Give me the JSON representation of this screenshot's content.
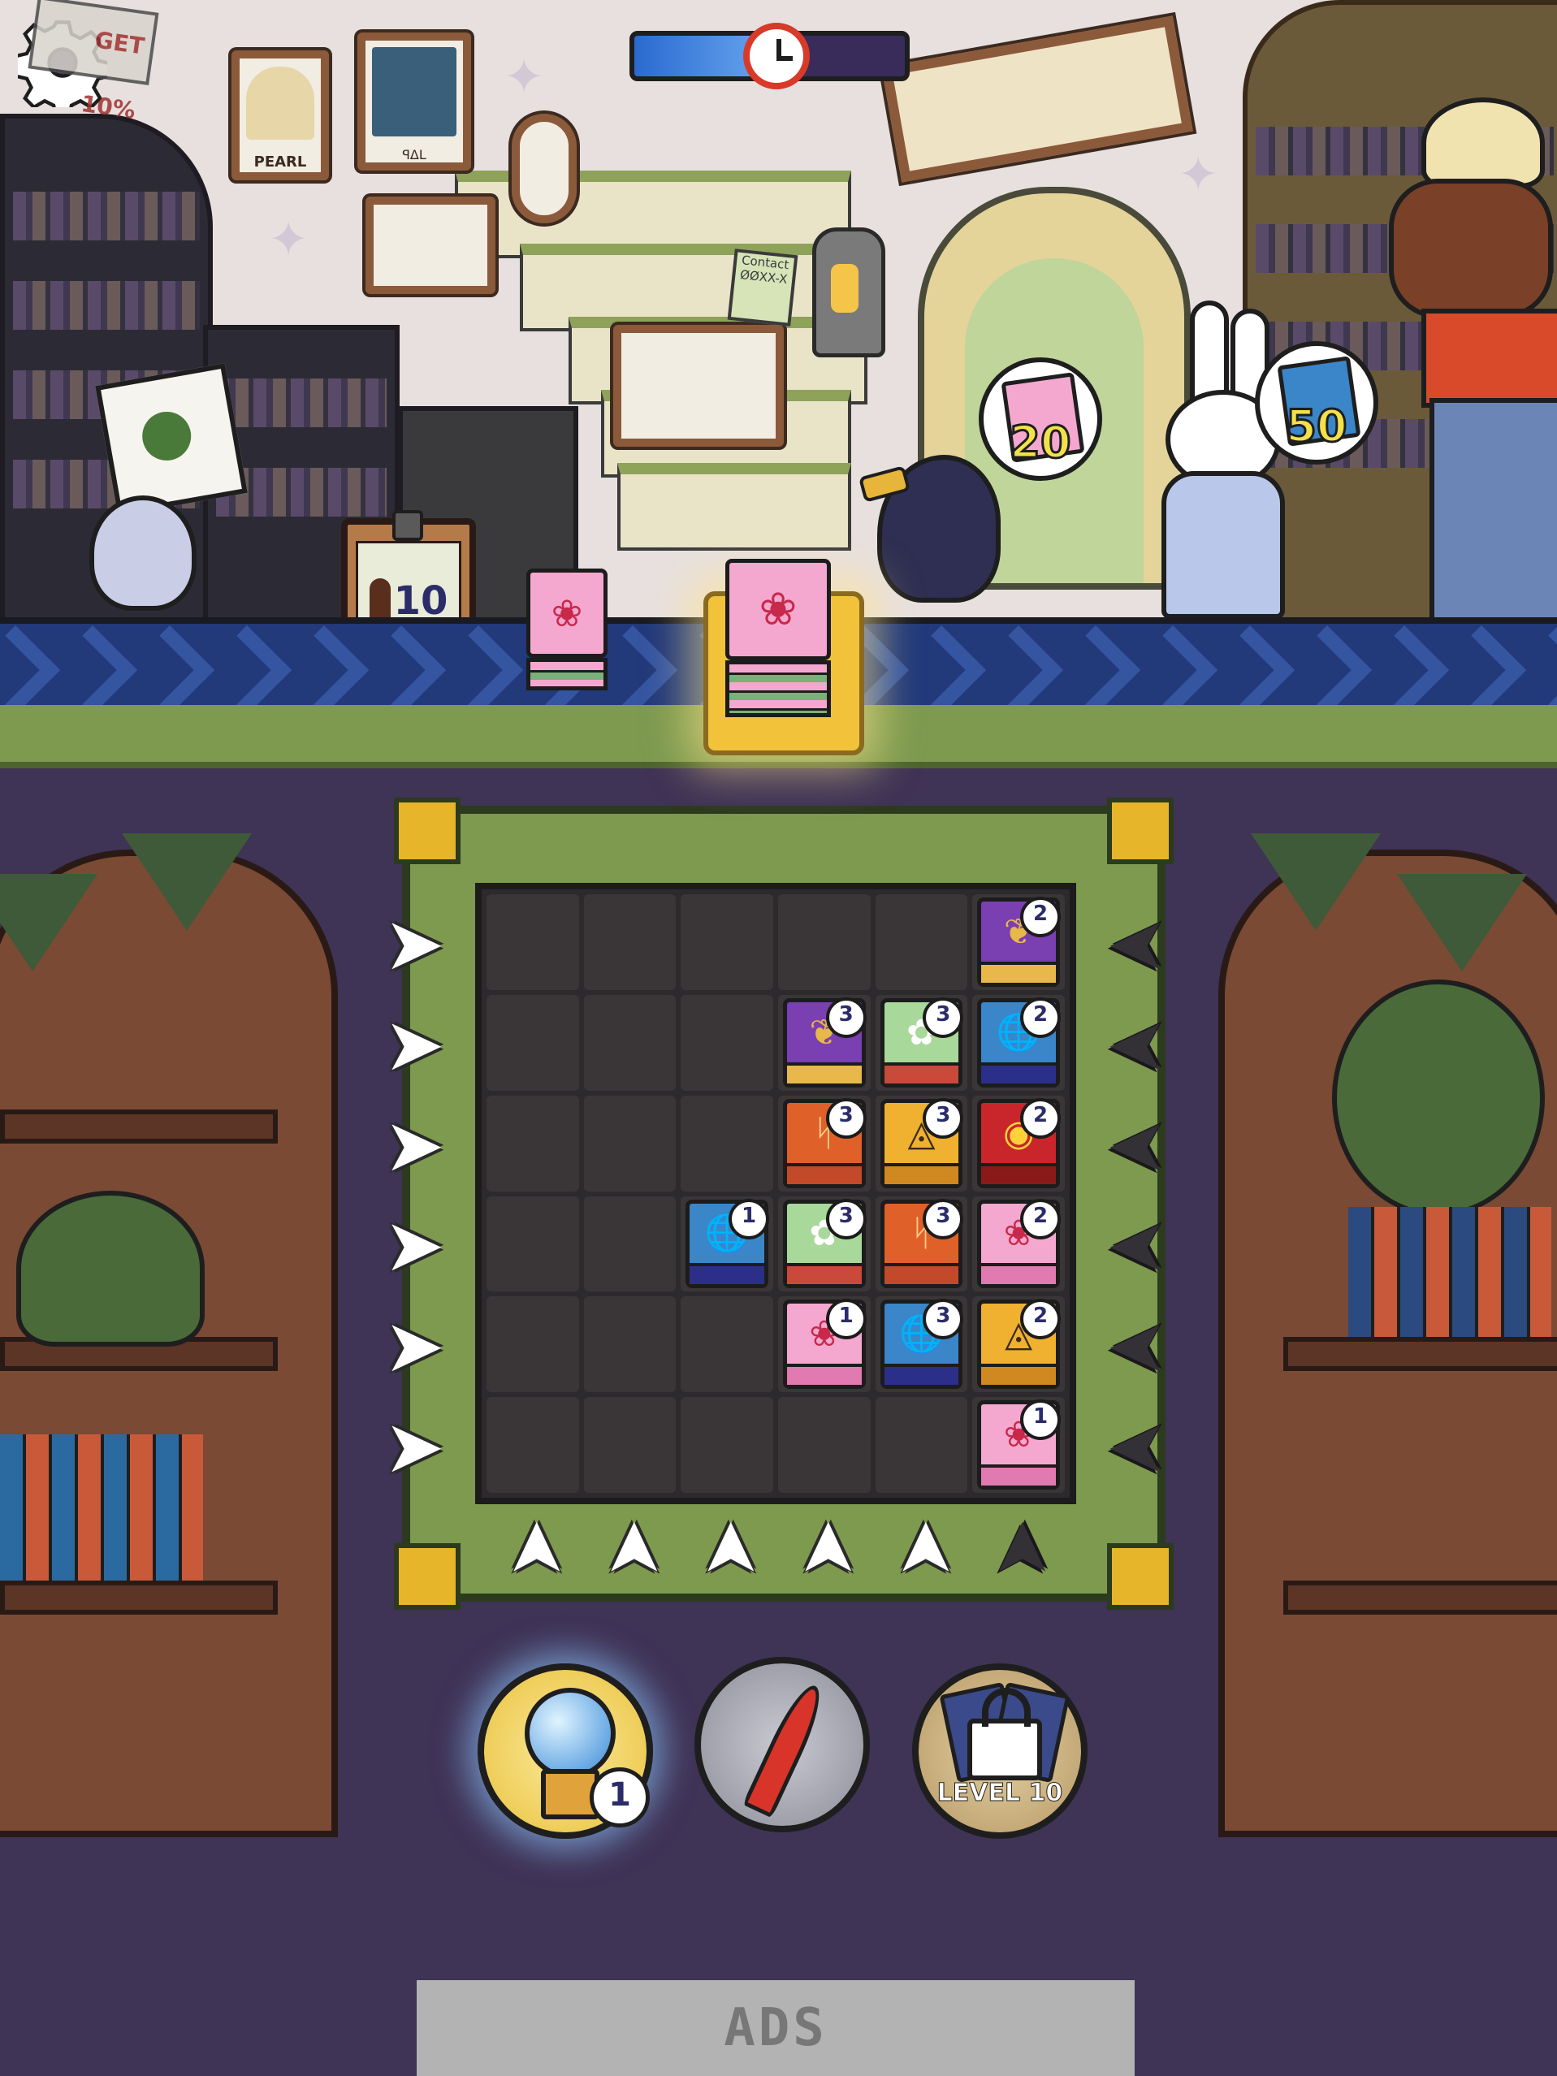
{
  "hud": {
    "settings_icon": "gear-icon",
    "timer_icon": "alarm-clock-icon",
    "timer_progress": 0.52,
    "sign_text": "GET 10%"
  },
  "scene": {
    "frames": [
      "PEARL",
      "ꟼΔL"
    ],
    "notice": "Contact",
    "notice_number": "ØØXX-X"
  },
  "order_clipboard": {
    "icon": "person-icon",
    "value": "10"
  },
  "customers": [
    {
      "name": "crow",
      "request_book": "rose",
      "request_count": "20"
    },
    {
      "name": "rabbit",
      "request_book": "globe",
      "request_count": "50"
    },
    {
      "name": "moose"
    }
  ],
  "conveyor": {
    "books": [
      "rose",
      "rose"
    ]
  },
  "grid": {
    "rows": [
      [
        null,
        null,
        null,
        null,
        null,
        {
          "type": "vine",
          "count": "2"
        }
      ],
      [
        null,
        null,
        null,
        {
          "type": "vine",
          "count": "3"
        },
        {
          "type": "flower",
          "count": "3"
        },
        {
          "type": "globe",
          "count": "2"
        }
      ],
      [
        null,
        null,
        null,
        {
          "type": "rune",
          "count": "3"
        },
        {
          "type": "triangle",
          "count": "3"
        },
        {
          "type": "eye",
          "count": "2"
        }
      ],
      [
        null,
        null,
        {
          "type": "globe",
          "count": "1"
        },
        {
          "type": "flower",
          "count": "3"
        },
        {
          "type": "rune",
          "count": "3"
        },
        {
          "type": "rose",
          "count": "2"
        }
      ],
      [
        null,
        null,
        null,
        {
          "type": "rose",
          "count": "1"
        },
        {
          "type": "globe",
          "count": "3"
        },
        {
          "type": "triangle",
          "count": "2"
        }
      ],
      [
        null,
        null,
        null,
        null,
        null,
        {
          "type": "rose",
          "count": "1"
        }
      ]
    ],
    "left_arrows": [
      "light",
      "light",
      "light",
      "light",
      "light",
      "light"
    ],
    "right_arrows": [
      "dark",
      "dark",
      "dark",
      "dark",
      "dark",
      "dark"
    ],
    "bottom_arrows": [
      "light",
      "light",
      "light",
      "light",
      "light",
      "dark"
    ]
  },
  "book_styles": {
    "vine": {
      "bg": "#7a3fb0",
      "emb": "❦",
      "emb_color": "#e8b84a",
      "spine": "#e8b84a"
    },
    "flower": {
      "bg": "#a8d89a",
      "emb": "✿",
      "emb_color": "#ffffff",
      "spine": "#c94a3a"
    },
    "globe": {
      "bg": "#3a86c8",
      "emb": "🌐",
      "emb_color": "#ffffff",
      "spine": "#2b2f8a"
    },
    "rune": {
      "bg": "#e0602a",
      "emb": "ᛋ",
      "emb_color": "#ffcc88",
      "spine": "#c24a2a"
    },
    "triangle": {
      "bg": "#f0b030",
      "emb": "◬",
      "emb_color": "#3a2a1a",
      "spine": "#d08820"
    },
    "eye": {
      "bg": "#c8262a",
      "emb": "◉",
      "emb_color": "#ffd23a",
      "spine": "#8a1a1a"
    },
    "rose": {
      "bg": "#f4a8d0",
      "emb": "❀",
      "emb_color": "#c8284a",
      "spine": "#e07ab0"
    }
  },
  "powerups": [
    {
      "name": "crystal-ball",
      "icon": "crystal-ball-icon",
      "count": "1",
      "bg": "#f3d76a"
    },
    {
      "name": "quill",
      "icon": "quill-icon",
      "bg": "#9a9aa6"
    },
    {
      "name": "cards",
      "icon": "lock-icon",
      "label": "LEVEL 10",
      "bg": "#c7b083"
    }
  ],
  "ads": {
    "label": "ADS"
  }
}
